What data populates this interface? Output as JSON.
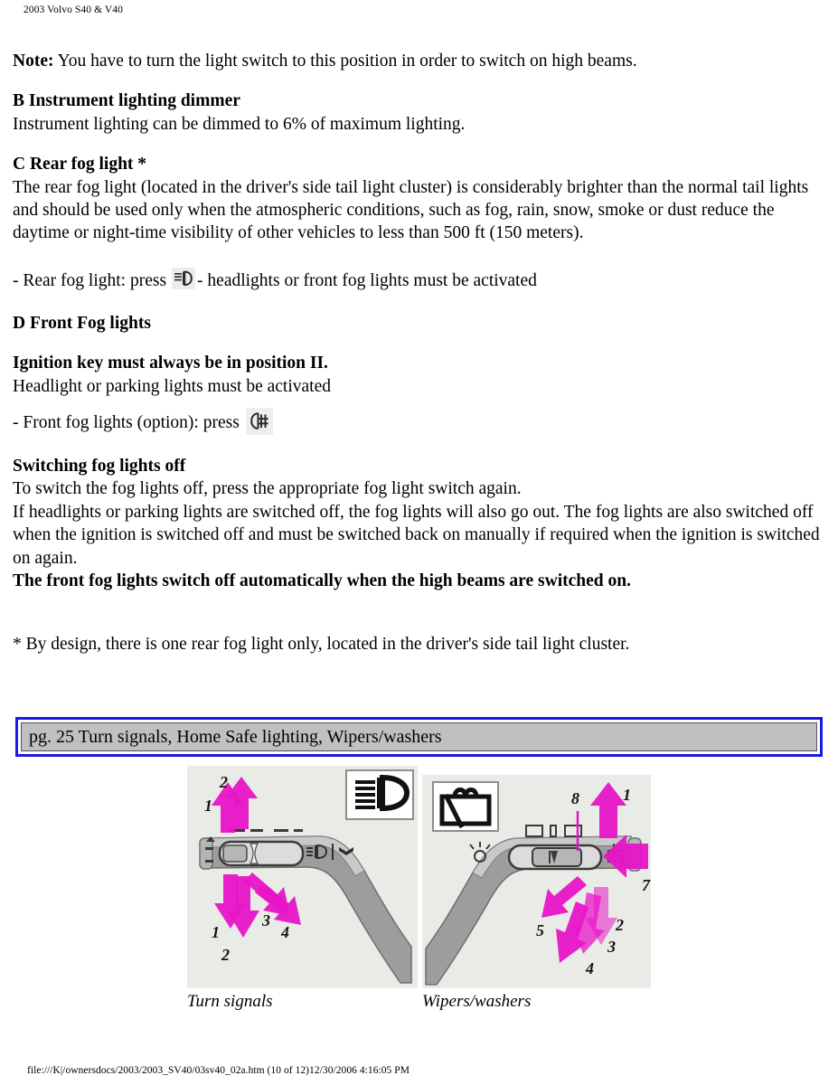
{
  "header": {
    "running_title": "2003 Volvo S40 & V40"
  },
  "content": {
    "note_label": "Note:",
    "note_text": " You have to turn the light switch to this position in order to switch on high beams.",
    "section_b": {
      "heading": "B Instrument lighting dimmer",
      "body": "Instrument lighting can be dimmed to 6% of maximum lighting."
    },
    "section_c": {
      "heading": "C Rear fog light *",
      "body": "The rear fog light (located in the driver's side tail light cluster) is considerably brighter than the normal tail lights and should be used only when the atmospheric conditions, such as fog, rain, snow, smoke or dust reduce the daytime or night-time visibility of other vehicles to less than 500 ft (150 meters).",
      "bullet_prefix": "- Rear fog light: press",
      "bullet_icon": "rear-fog-light-symbol",
      "bullet_suffix": "- headlights or front fog lights must be activated"
    },
    "section_d": {
      "heading": "D Front Fog lights",
      "ignition_line": "Ignition key must always be in position II.",
      "activation_line": "Headlight or parking lights must be activated",
      "bullet_prefix": "- Front fog lights (option): press",
      "bullet_icon": "front-fog-light-symbol"
    },
    "switching_off": {
      "heading": "Switching fog lights off",
      "line1": "To switch the fog lights off, press the appropriate fog light switch again.",
      "line2": "If headlights or parking lights are switched off, the fog lights will also go out. The fog lights are also switched off when the ignition is switched off and must be switched back on manually if required when the ignition is switched on again.",
      "line3": "The front fog lights switch off automatically when the high beams are switched on."
    },
    "footnote": "* By design, there is one rear fog light only, located in the driver's side tail light cluster."
  },
  "banner": {
    "text": "pg. 25 Turn signals, Home Safe lighting, Wipers/washers",
    "border_color": "#1a1ae0",
    "fill_color": "#c0c0c0"
  },
  "figures": {
    "left": {
      "caption": "Turn signals",
      "icon_name": "high-beam-icon",
      "arrow_labels": [
        "2",
        "1",
        "1",
        "2",
        "3",
        "4"
      ],
      "background_color": "#e9ebe6",
      "arrow_color": "#e815c8"
    },
    "right": {
      "caption": "Wipers/washers",
      "icon_name": "windshield-wiper-icon",
      "arrow_labels": [
        "8",
        "1",
        "7",
        "5",
        "2",
        "3",
        "4"
      ],
      "background_color": "#e9ebe6",
      "arrow_color": "#e815c8"
    }
  },
  "footer": {
    "path_line": "file:///K|/ownersdocs/2003/2003_SV40/03sv40_02a.htm (10 of 12)12/30/2006 4:16:05 PM"
  }
}
